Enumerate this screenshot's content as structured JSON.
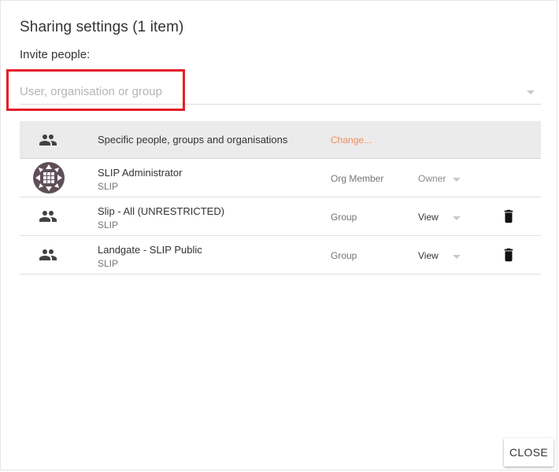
{
  "dialog": {
    "title": "Sharing settings (1 item)",
    "invite_label": "Invite people:",
    "search": {
      "placeholder": "User, organisation or group",
      "value": ""
    }
  },
  "access": {
    "label": "Specific people, groups and organisations",
    "change_label": "Change...",
    "icon": "people-icon"
  },
  "members": [
    {
      "name": "SLIP Administrator",
      "org": "SLIP",
      "type": "Org Member",
      "permission": "Owner",
      "icon": "org-avatar",
      "removable": false
    },
    {
      "name": "Slip - All (UNRESTRICTED)",
      "org": "SLIP",
      "type": "Group",
      "permission": "View",
      "icon": "people-icon",
      "removable": true
    },
    {
      "name": "Landgate - SLIP Public",
      "org": "SLIP",
      "type": "Group",
      "permission": "View",
      "icon": "people-icon",
      "removable": true
    }
  ],
  "footer": {
    "close_label": "CLOSE"
  },
  "colors": {
    "accent_link": "#f08a5d",
    "highlight": "#e31d2b",
    "header_bg": "#ebebeb"
  }
}
